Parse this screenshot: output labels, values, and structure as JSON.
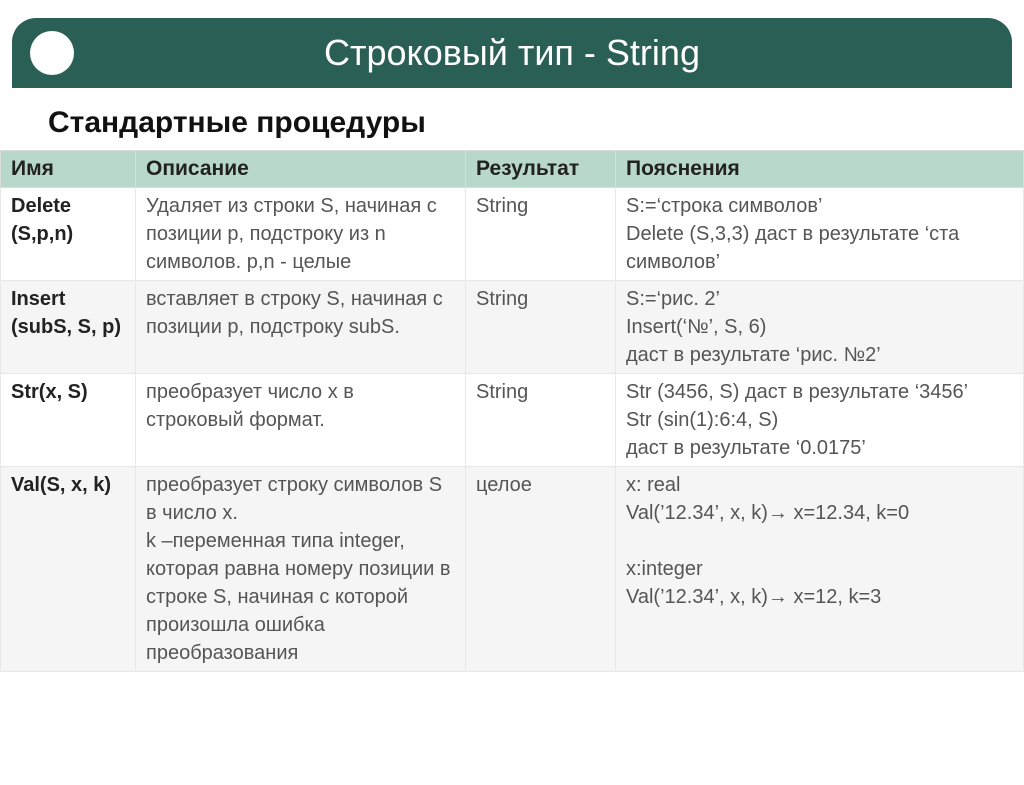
{
  "header": {
    "title": "Строковый тип - String"
  },
  "subtitle": "Стандартные процедуры",
  "table": {
    "headers": [
      "Имя",
      "Описание",
      "Результат",
      "Пояснения"
    ],
    "rows": [
      {
        "name": "Delete (S,p,n)",
        "desc": "Удаляет из строки S, начиная с позиции p, подстроку из n символов. p,n - целые",
        "result": "String",
        "note": "S:=‘строка символов’\nDelete (S,3,3) даст в результате ‘ста символов’"
      },
      {
        "name": "Insert (subS, S, p)",
        "desc": "вставляет в строку S, начиная с позиции p, подстроку subS.",
        "result": "String",
        "note": "S:=‘рис. 2’\nInsert(‘№’, S, 6)\nдаст в результате ‘рис. №2’"
      },
      {
        "name": "Str(x, S)",
        "desc": "преобразует число х в строковый формат.",
        "result": "String",
        "note": "Str (3456, S) даст в результате ‘3456’\nStr (sin(1):6:4, S)\nдаст в результате  ‘0.0175’"
      },
      {
        "name": "Val(S, x, k)",
        "desc": "преобразует строку символов S в число x.\nk –переменная типа integer, которая равна номеру позиции в строке S, начиная с которой произошла ошибка преобразования",
        "result": "целое",
        "note": "x: real\nVal(’12.34’, x, k)→ x=12.34, k=0\n\nx:integer\nVal(’12.34’, x, k)→ x=12, k=3"
      }
    ]
  }
}
